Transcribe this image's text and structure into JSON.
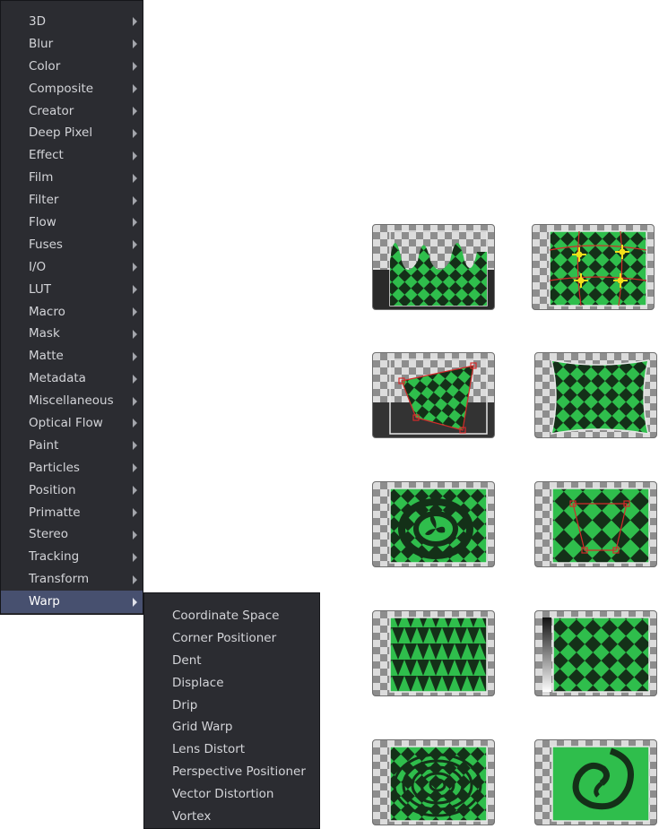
{
  "menu": {
    "items": [
      {
        "label": "3D"
      },
      {
        "label": "Blur"
      },
      {
        "label": "Color"
      },
      {
        "label": "Composite"
      },
      {
        "label": "Creator"
      },
      {
        "label": "Deep Pixel"
      },
      {
        "label": "Effect"
      },
      {
        "label": "Film"
      },
      {
        "label": "Filter"
      },
      {
        "label": "Flow"
      },
      {
        "label": "Fuses"
      },
      {
        "label": "I/O"
      },
      {
        "label": "LUT"
      },
      {
        "label": "Macro"
      },
      {
        "label": "Mask"
      },
      {
        "label": "Matte"
      },
      {
        "label": "Metadata"
      },
      {
        "label": "Miscellaneous"
      },
      {
        "label": "Optical Flow"
      },
      {
        "label": "Paint"
      },
      {
        "label": "Particles"
      },
      {
        "label": "Position"
      },
      {
        "label": "Primatte"
      },
      {
        "label": "Stereo"
      },
      {
        "label": "Tracking"
      },
      {
        "label": "Transform"
      },
      {
        "label": "Warp"
      }
    ],
    "active_item": "Warp"
  },
  "submenu": {
    "items": [
      {
        "label": "Coordinate Space"
      },
      {
        "label": "Corner Positioner"
      },
      {
        "label": "Dent"
      },
      {
        "label": "Displace"
      },
      {
        "label": "Drip"
      },
      {
        "label": "Grid Warp"
      },
      {
        "label": "Lens Distort"
      },
      {
        "label": "Perspective Positioner"
      },
      {
        "label": "Vector Distortion"
      },
      {
        "label": "Vortex"
      }
    ]
  },
  "thumbnails": [
    {
      "effect": "coordinate-space"
    },
    {
      "effect": "grid-warp"
    },
    {
      "effect": "corner-positioner"
    },
    {
      "effect": "lens-distort"
    },
    {
      "effect": "dent"
    },
    {
      "effect": "perspective-positioner"
    },
    {
      "effect": "displace"
    },
    {
      "effect": "vector-distortion"
    },
    {
      "effect": "drip"
    },
    {
      "effect": "vortex"
    }
  ],
  "colors": {
    "menu_bg": "#2b2c31",
    "menu_active": "#47506f",
    "menu_text": "#d3d4d8",
    "checker_green": "#2fbe4c",
    "checker_dark": "#143018",
    "control_red": "#d42a2a",
    "control_yellow": "#f3df1b"
  }
}
